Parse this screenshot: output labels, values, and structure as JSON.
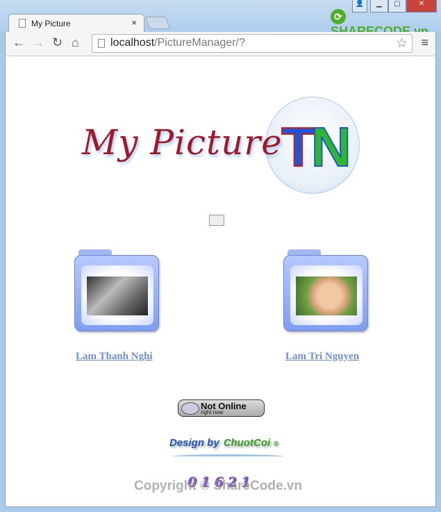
{
  "browser": {
    "tab_title": "My Picture",
    "tab_close": "×",
    "url_host": "localhost",
    "url_path": "/PictureManager/?",
    "watermark_logo": "SHARECODE.vn"
  },
  "page": {
    "banner_title": "My Picture",
    "banner_logo": "TN",
    "folders": [
      {
        "label": "Lam Thanh Nghi"
      },
      {
        "label": "Lam Tri Nguyen"
      }
    ],
    "status": {
      "main": "Not Online",
      "sub": "right now"
    },
    "credit": {
      "design_by": "Design by",
      "author": "ChuotCoi",
      "mark": "®"
    },
    "visit_counter": "01621",
    "watermark": "Copyright © ShareCode.vn"
  }
}
